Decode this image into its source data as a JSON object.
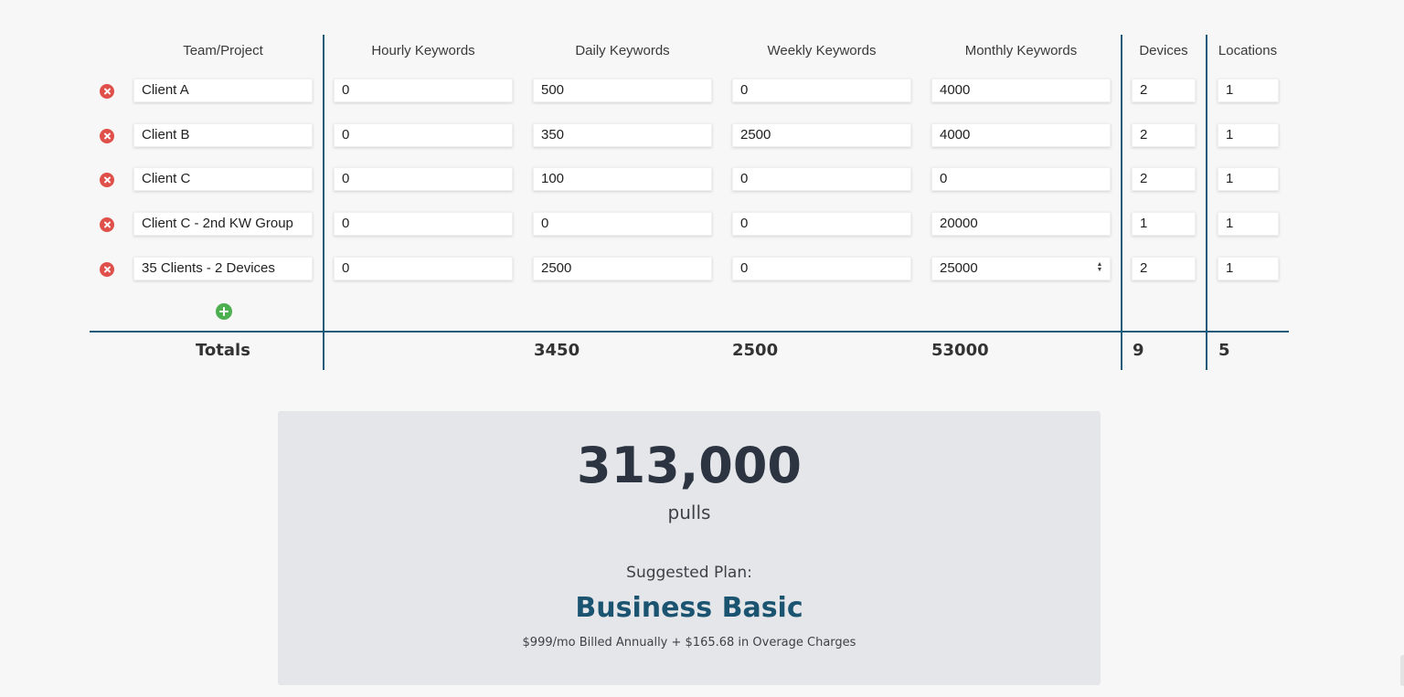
{
  "headers": {
    "team": "Team/Project",
    "hourly": "Hourly Keywords",
    "daily": "Daily Keywords",
    "weekly": "Weekly Keywords",
    "monthly": "Monthly Keywords",
    "devices": "Devices",
    "locations": "Locations"
  },
  "rows": [
    {
      "name": "Client A",
      "hourly": "0",
      "daily": "500",
      "weekly": "0",
      "monthly": "4000",
      "devices": "2",
      "locations": "1"
    },
    {
      "name": "Client B",
      "hourly": "0",
      "daily": "350",
      "weekly": "2500",
      "monthly": "4000",
      "devices": "2",
      "locations": "1"
    },
    {
      "name": "Client C",
      "hourly": "0",
      "daily": "100",
      "weekly": "0",
      "monthly": "0",
      "devices": "2",
      "locations": "1"
    },
    {
      "name": "Client C - 2nd KW Group",
      "hourly": "0",
      "daily": "0",
      "weekly": "0",
      "monthly": "20000",
      "devices": "1",
      "locations": "1"
    },
    {
      "name": "35 Clients - 2 Devices",
      "hourly": "0",
      "daily": "2500",
      "weekly": "0",
      "monthly": "25000",
      "devices": "2",
      "locations": "1"
    }
  ],
  "totals": {
    "label": "Totals",
    "daily": "3450",
    "weekly": "2500",
    "monthly": "53000",
    "devices": "9",
    "locations": "5"
  },
  "result": {
    "pulls": "313,000",
    "unit": "pulls",
    "suggested_label": "Suggested Plan:",
    "plan_name": "Business Basic",
    "price_line": "$999/mo Billed Annually + $165.68 in Overage Charges"
  },
  "colors": {
    "divider": "#1f5a7a",
    "remove": "#e0504a",
    "add": "#4caf50",
    "plan": "#1b5470"
  },
  "icons": {
    "remove": "remove-circle-icon",
    "add": "add-circle-icon",
    "spinner": "number-spinner-icon"
  }
}
